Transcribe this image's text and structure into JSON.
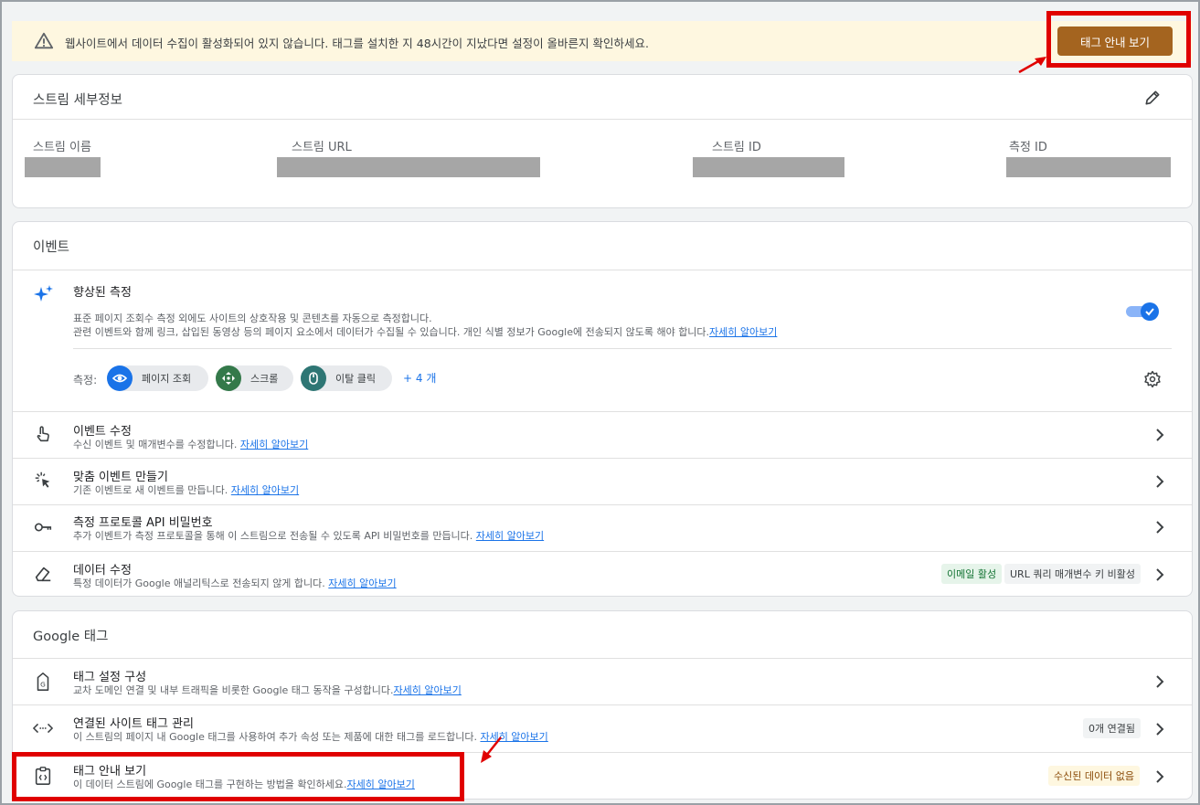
{
  "banner": {
    "message": "웹사이트에서 데이터 수집이 활성화되어 있지 않습니다. 태그를 설치한 지 48시간이 지났다면 설정이 올바른지 확인하세요.",
    "button_label": "태그 안내 보기"
  },
  "stream_details": {
    "title": "스트림 세부정보",
    "fields": [
      {
        "label": "스트림 이름"
      },
      {
        "label": "스트림 URL"
      },
      {
        "label": "스트림 ID"
      },
      {
        "label": "측정 ID"
      }
    ]
  },
  "events": {
    "title": "이벤트",
    "enhanced": {
      "title": "향상된 측정",
      "desc1": "표준 페이지 조회수 측정 외에도 사이트의 상호작용 및 콘텐츠를 자동으로 측정합니다.",
      "desc2": "관련 이벤트와 함께 링크, 삽입된 동영상 등의 페이지 요소에서 데이터가 수집될 수 있습니다. 개인 식별 정보가 Google에 전송되지 않도록 해야 합니다.",
      "learn_more": "자세히 알아보기",
      "toggle_on": true,
      "measure_label": "측정:",
      "chips": [
        "페이지 조회",
        "스크롤",
        "이탈 클릭"
      ],
      "more": "+ 4 개"
    },
    "rows": [
      {
        "title": "이벤트 수정",
        "sub": "수신 이벤트 및 매개변수를 수정합니다.",
        "link": "자세히 알아보기"
      },
      {
        "title": "맞춤 이벤트 만들기",
        "sub": "기존 이벤트로 새 이벤트를 만듭니다.",
        "link": "자세히 알아보기"
      },
      {
        "title": "측정 프로토콜 API 비밀번호",
        "sub": "추가 이벤트가 측정 프로토콜을 통해 이 스트림으로 전송될 수 있도록 API 비밀번호를 만듭니다.",
        "link": "자세히 알아보기"
      },
      {
        "title": "데이터 수정",
        "sub": "특정 데이터가 Google 애널리틱스로 전송되지 않게 합니다.",
        "link": "자세히 알아보기",
        "badges": [
          "이메일 활성",
          "URL 쿼리 매개변수 키 비활성"
        ]
      }
    ]
  },
  "google_tag": {
    "title": "Google 태그",
    "rows": [
      {
        "title": "태그 설정 구성",
        "sub": "교차 도메인 연결 및 내부 트래픽을 비롯한 Google 태그 동작을 구성합니다.",
        "link": "자세히 알아보기"
      },
      {
        "title": "연결된 사이트 태그 관리",
        "sub": "이 스트림의 페이지 내 Google 태그를 사용하여 추가 속성 또는 제품에 대한 태그를 로드합니다.",
        "link": "자세히 알아보기",
        "badge": "0개 연결됨"
      },
      {
        "title": "태그 안내 보기",
        "sub": "이 데이터 스트림에 Google 태그를 구현하는 방법을 확인하세요.",
        "link": "자세히 알아보기",
        "badge": "수신된 데이터 없음"
      }
    ]
  },
  "colors": {
    "banner_bg": "#fef7e0",
    "button_bg": "#a4641f",
    "accent_blue": "#1a73e8",
    "highlight_red": "#e00000"
  }
}
